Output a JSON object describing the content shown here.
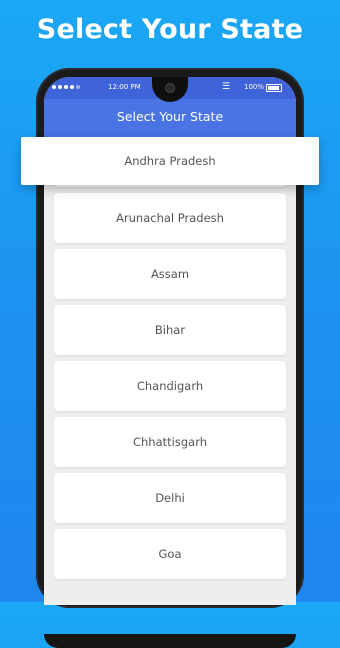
{
  "headline": "Select Your State",
  "status_bar": {
    "time": "12:00 PM",
    "battery": "100%",
    "icons": [
      "signal-dots-icon",
      "wifi-icon",
      "battery-icon"
    ]
  },
  "app_bar": {
    "title": "Select Your  State"
  },
  "states": [
    {
      "label": "Andhra Pradesh",
      "selected": true
    },
    {
      "label": "Arunachal Pradesh"
    },
    {
      "label": "Assam"
    },
    {
      "label": "Bihar"
    },
    {
      "label": "Chandigarh"
    },
    {
      "label": "Chhattisgarh"
    },
    {
      "label": "Delhi"
    },
    {
      "label": "Goa"
    }
  ],
  "colors": {
    "background": "#1e8ff0",
    "status_bar": "#3f63d8",
    "app_bar": "#4a73e3",
    "list_bg": "#eeeeee",
    "item_text": "#555555"
  }
}
